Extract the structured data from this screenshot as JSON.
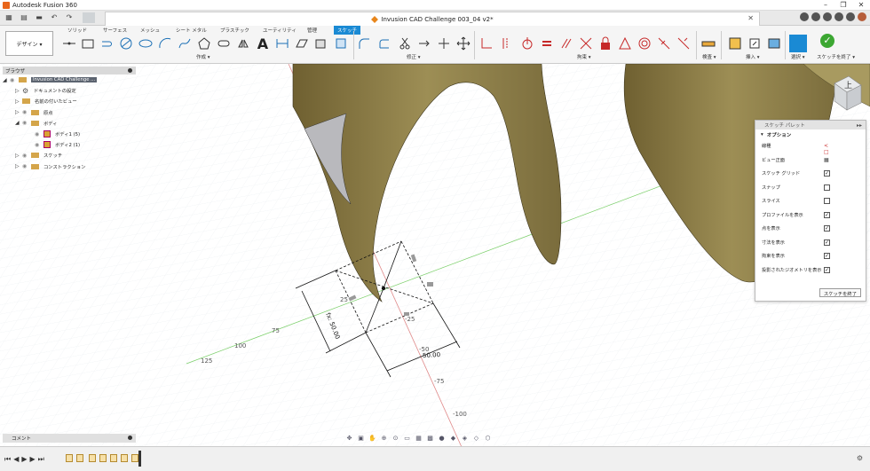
{
  "titlebar": {
    "title": "Autodesk Fusion 360",
    "min": "–",
    "max": "❐",
    "close": "✕"
  },
  "document": {
    "title": "Invusion CAD Challenge 003_04 v2*",
    "close": "✕"
  },
  "ribbon": {
    "workspace": "デザイン ▾",
    "tabs": [
      "ソリッド",
      "サーフェス",
      "メッシュ",
      "シート メタル",
      "プラスチック",
      "ユーティリティ",
      "管理",
      "スケッチ"
    ],
    "active_tab": "スケッチ",
    "groups": {
      "create": "作成 ▾",
      "modify": "修正 ▾",
      "constraints": "拘束 ▾",
      "inspect": "検査 ▾",
      "insert": "挿入 ▾",
      "select": "選択 ▾",
      "finish": "スケッチを終了 ▾"
    },
    "accent": "#1a8ad4"
  },
  "browser": {
    "title": "ブラウザ",
    "root": "Invusion CAD Challenge ...",
    "items": [
      {
        "label": "ドキュメントの設定"
      },
      {
        "label": "名前の付いたビュー"
      },
      {
        "label": "原点"
      },
      {
        "label": "ボディ"
      },
      {
        "label": "ボディ1 (5)"
      },
      {
        "label": "ボディ2 (1)"
      },
      {
        "label": "スケッチ"
      },
      {
        "label": "コンストラクション"
      }
    ]
  },
  "palette": {
    "title": "スケッチ パレット",
    "section": "オプション",
    "rows": [
      {
        "label": "線種",
        "type": "icon"
      },
      {
        "label": "ビュー正面",
        "type": "icon"
      },
      {
        "label": "スケッチ グリッド",
        "checked": true
      },
      {
        "label": "スナップ",
        "checked": false
      },
      {
        "label": "スライス",
        "checked": false
      },
      {
        "label": "プロファイルを表示",
        "checked": true
      },
      {
        "label": "点を表示",
        "checked": true
      },
      {
        "label": "寸法を表示",
        "checked": true
      },
      {
        "label": "拘束を表示",
        "checked": true
      },
      {
        "label": "投影されたジオメトリを表示",
        "checked": true
      }
    ],
    "finish_button": "スケッチを終了"
  },
  "viewcube": {
    "face": "上"
  },
  "canvas": {
    "axis_labels": [
      "125",
      "100",
      "75",
      "25",
      "-25",
      "-50",
      "-75",
      "-100"
    ],
    "dimension_1": "fx: 50.00",
    "dimension_2": "50.00"
  },
  "comment": {
    "label": "コメント"
  },
  "timeline": {
    "controls": "⏮◀▶▶⏭"
  }
}
